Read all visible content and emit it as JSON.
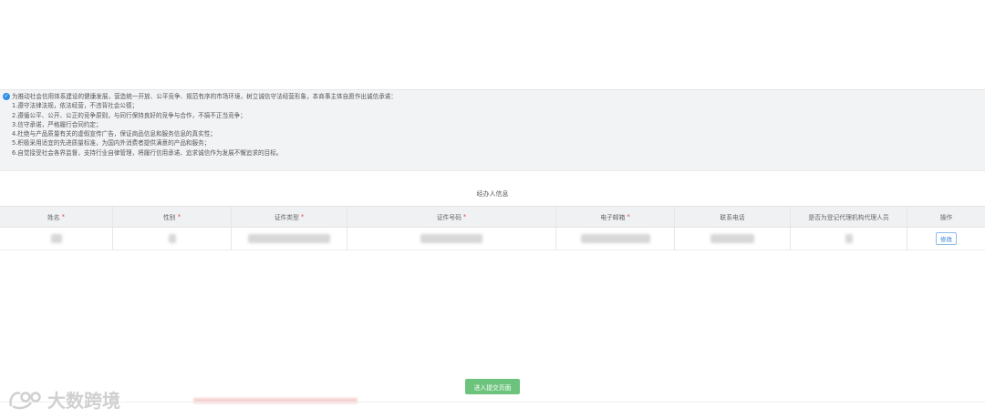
{
  "pledge": {
    "intro": "为推动社会信用体系建设的健康发展，营造统一开放、公平竞争、规范有序的市场环境，树立诚信守法经营形象，本商事主体自愿作出诚信承诺：",
    "items": [
      "1.遵守法律法规，依法经营，不违背社会公德；",
      "2.遵循公平、公开、公正的竞争原则，与同行保持良好的竞争与合作，不搞不正当竞争；",
      "3.信守承诺，严格履行合同约定；",
      "4.杜绝与产品质量有关的虚假宣传广告，保证商品信息和服务信息的真实性；",
      "5.积极采用适宜的先进质量标准，为国内外消费者提供满意的产品和服务；",
      "6.自觉接受社会各界监督，支持行业自律管理，将履行信用承诺、追求诚信作为发展不懈追求的目标。"
    ]
  },
  "section": {
    "title": "经办人信息"
  },
  "table": {
    "headers": [
      "姓名",
      "性别",
      "证件类型",
      "证件号码",
      "电子邮箱",
      "联系电话",
      "是否为登记代理机构代理人员",
      "操作"
    ],
    "required_mark": "*",
    "action_label": "修改"
  },
  "footer": {
    "submit_label": "进入提交页面"
  },
  "watermark": {
    "text": "大数跨境"
  }
}
